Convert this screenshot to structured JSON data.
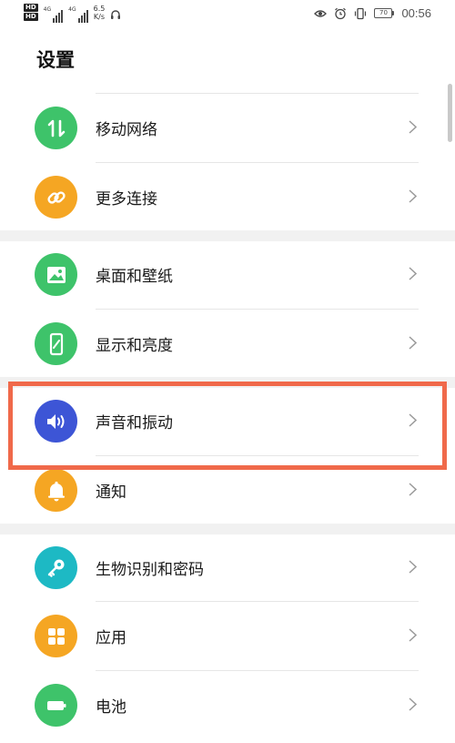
{
  "status_bar": {
    "hd1": "HD",
    "hd2": "HD",
    "net1": "4G",
    "net2": "4G",
    "speed_value": "6.5",
    "speed_unit": "K/s",
    "battery": "70",
    "time": "00:56"
  },
  "page": {
    "title": "设置"
  },
  "menu": [
    {
      "label": "移动网络",
      "icon": "mobile-data-icon",
      "color": "#3ec36a"
    },
    {
      "label": "更多连接",
      "icon": "link-icon",
      "color": "#f5a623"
    },
    {
      "label": "桌面和壁纸",
      "icon": "wallpaper-icon",
      "color": "#3ec36a"
    },
    {
      "label": "显示和亮度",
      "icon": "display-icon",
      "color": "#3ec36a"
    },
    {
      "label": "声音和振动",
      "icon": "sound-icon",
      "color": "#3d55d6"
    },
    {
      "label": "通知",
      "icon": "bell-icon",
      "color": "#f5a623"
    },
    {
      "label": "生物识别和密码",
      "icon": "key-icon",
      "color": "#1db9c4"
    },
    {
      "label": "应用",
      "icon": "apps-icon",
      "color": "#f5a623"
    },
    {
      "label": "电池",
      "icon": "battery-icon",
      "color": "#3ec36a"
    }
  ],
  "colors": {
    "highlight_border": "#f0694a",
    "chevron": "#9a9a9a"
  }
}
